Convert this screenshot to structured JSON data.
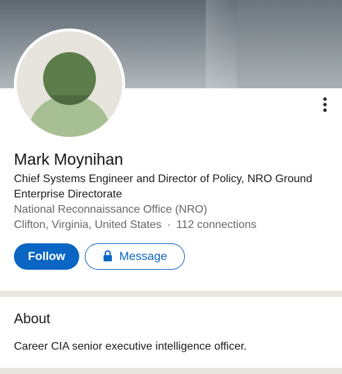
{
  "profile": {
    "name": "Mark Moynihan",
    "headline": "Chief Systems Engineer and Director of Policy, NRO Ground Enterprise Directorate",
    "organization": "National Reconnaissance Office (NRO)",
    "location": "Clifton, Virginia, United States",
    "separator": "·",
    "connections": "112 connections"
  },
  "actions": {
    "follow_label": "Follow",
    "message_label": "Message",
    "more_icon": "more-vertical-icon",
    "lock_icon": "lock-icon"
  },
  "about": {
    "title": "About",
    "text": "Career CIA senior executive intelligence officer."
  },
  "colors": {
    "accent": "#0a66c2",
    "avatar_head": "#5d7d4b",
    "avatar_body": "#a6bf93",
    "avatar_bg": "#e7e4de",
    "divider": "#e9e6df"
  }
}
